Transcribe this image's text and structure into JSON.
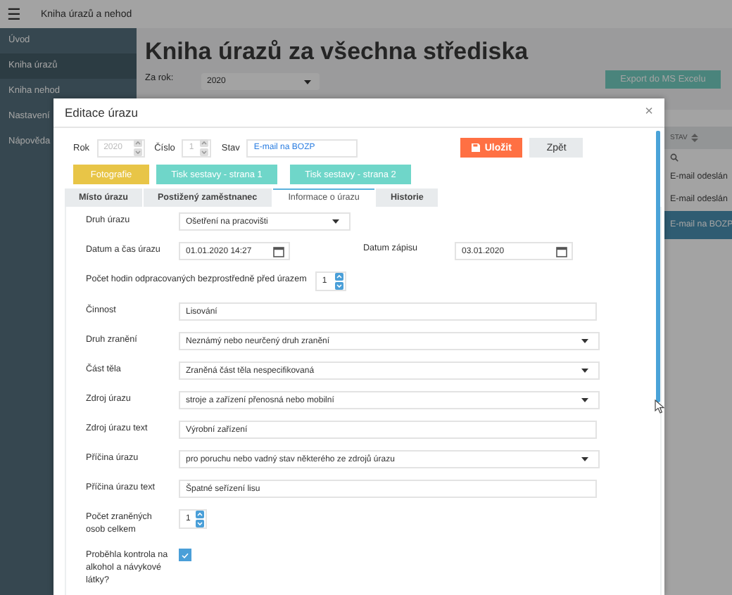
{
  "app_bar": {
    "menu_icon": "☰",
    "title": "Kniha úrazů a nehod"
  },
  "sidebar": {
    "items": [
      {
        "label": "Úvod",
        "selected": false
      },
      {
        "label": "Kniha úrazů",
        "selected": true
      },
      {
        "label": "Kniha nehod",
        "selected": false
      },
      {
        "label": "Nastavení",
        "selected": false
      },
      {
        "label": "Nápověda",
        "selected": false
      }
    ]
  },
  "page": {
    "title": "Kniha úrazů za všechna střediska",
    "year_label": "Za rok:",
    "year_value": "2020",
    "export_button": "Export do MS Excelu"
  },
  "table": {
    "columns": [
      "STAV"
    ],
    "rows": [
      {
        "status": "E-mail odeslán",
        "selected": false
      },
      {
        "status": "E-mail odeslán",
        "selected": false
      },
      {
        "status": "E-mail na BOZP",
        "selected": true
      }
    ]
  },
  "modal": {
    "title": "Editace úrazu",
    "close": "×",
    "rok_label": "Rok",
    "rok_value": "2020",
    "cislo_label": "Číslo",
    "cislo_value": "1",
    "stav_label": "Stav",
    "stav_value": "E-mail na BOZP",
    "save_button": "Uložit",
    "back_button": "Zpět",
    "action_buttons": [
      {
        "label": "Fotografie",
        "color": "#e8c547"
      },
      {
        "label": "Tisk sestavy - strana 1",
        "color": "#6fd6c9"
      },
      {
        "label": "Tisk sestavy - strana 2",
        "color": "#6fd6c9"
      }
    ],
    "tabs": [
      {
        "label": "Místo úrazu",
        "selected": false
      },
      {
        "label": "Postižený zaměstnanec",
        "selected": false
      },
      {
        "label": "Informace o úrazu",
        "selected": true
      },
      {
        "label": "Historie",
        "selected": false
      }
    ],
    "form": [
      {
        "kind": "select",
        "label": "Druh úrazu",
        "value": "Ošetření na pracovišti"
      },
      {
        "kind": "date_pair",
        "label": "Datum a čas úrazu",
        "value": "01.01.2020 14:27",
        "label_2": "Datum zápisu",
        "value_2": "03.01.2020"
      },
      {
        "kind": "number_inline",
        "label": "Počet hodin odpracovaných bezprostředně před úrazem",
        "value": "1"
      },
      {
        "kind": "text",
        "label": "Činnost",
        "value": "Lisování"
      },
      {
        "kind": "select",
        "label": "Druh zranění",
        "value": "Neznámý nebo neurčený druh zranění"
      },
      {
        "kind": "select",
        "label": "Část těla",
        "value": "Zraněná část těla nespecifikovaná"
      },
      {
        "kind": "select",
        "label": "Zdroj úrazu",
        "value": "stroje a zařízení přenosná nebo mobilní"
      },
      {
        "kind": "text",
        "label": "Zdroj úrazu text",
        "value": "Výrobní zařízení"
      },
      {
        "kind": "select",
        "label": "Příčina úrazu",
        "value": "pro poruchu nebo vadný stav některého ze zdrojů úrazu"
      },
      {
        "kind": "text",
        "label": "Příčina úrazu text",
        "value": "Špatné seřízení lisu"
      },
      {
        "kind": "number",
        "label": "Počet zraněných osob celkem",
        "value": "1"
      },
      {
        "kind": "checkbox",
        "label": "Proběhla kontrola na alkohol a návykové látky?",
        "checked": true
      }
    ]
  }
}
